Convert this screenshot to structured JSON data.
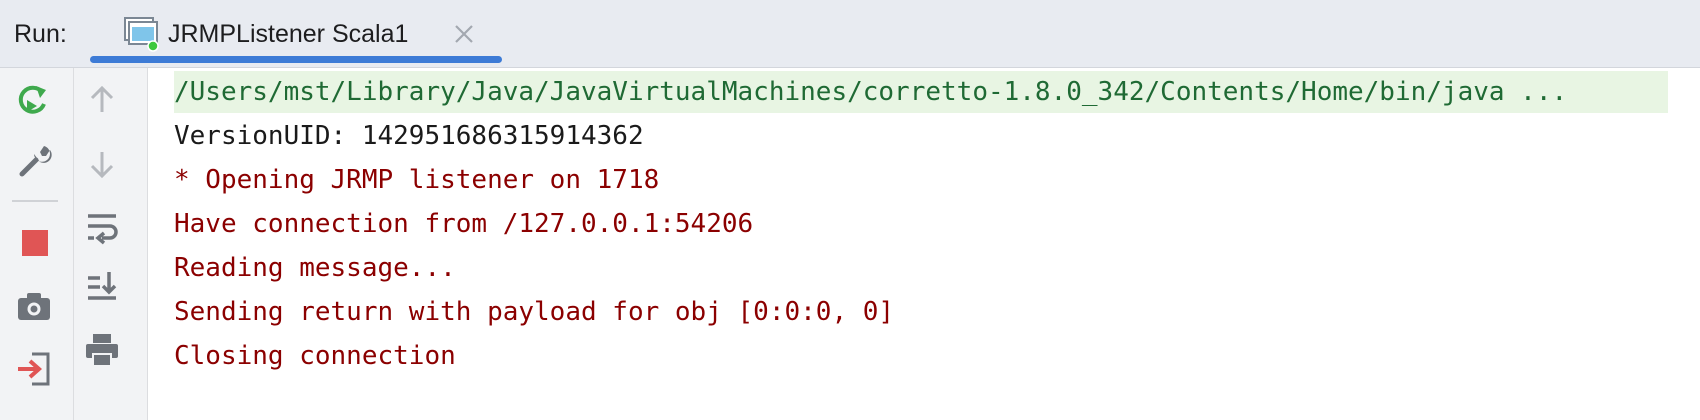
{
  "header": {
    "run_label": "Run:",
    "tab": {
      "title": "JRMPListener Scala1",
      "icon": "run-configuration-icon",
      "status": "running"
    }
  },
  "toolbar_left": [
    {
      "name": "rerun-icon"
    },
    {
      "name": "wrench-icon"
    },
    {
      "name": "stop-icon"
    },
    {
      "name": "camera-icon"
    },
    {
      "name": "exit-icon"
    }
  ],
  "toolbar_right": [
    {
      "name": "arrow-up-icon"
    },
    {
      "name": "arrow-down-icon"
    },
    {
      "name": "soft-wrap-icon"
    },
    {
      "name": "scroll-to-end-icon"
    },
    {
      "name": "print-icon"
    }
  ],
  "console": {
    "command": "/Users/mst/Library/Java/JavaVirtualMachines/corretto-1.8.0_342/Contents/Home/bin/java ...",
    "lines": [
      {
        "text": "VersionUID: 142951686315914362",
        "type": "stdout"
      },
      {
        "text": "* Opening JRMP listener on 1718",
        "type": "stderr"
      },
      {
        "text": "Have connection from /127.0.0.1:54206",
        "type": "stderr"
      },
      {
        "text": "Reading message...",
        "type": "stderr"
      },
      {
        "text": "Sending return with payload for obj [0:0:0, 0]",
        "type": "stderr"
      },
      {
        "text": "Closing connection",
        "type": "stderr"
      }
    ]
  },
  "colors": {
    "stdout": "#1a1a1a",
    "stderr": "#8b0000",
    "command_text": "#1f6a34",
    "accent": "#3d7bd6"
  }
}
